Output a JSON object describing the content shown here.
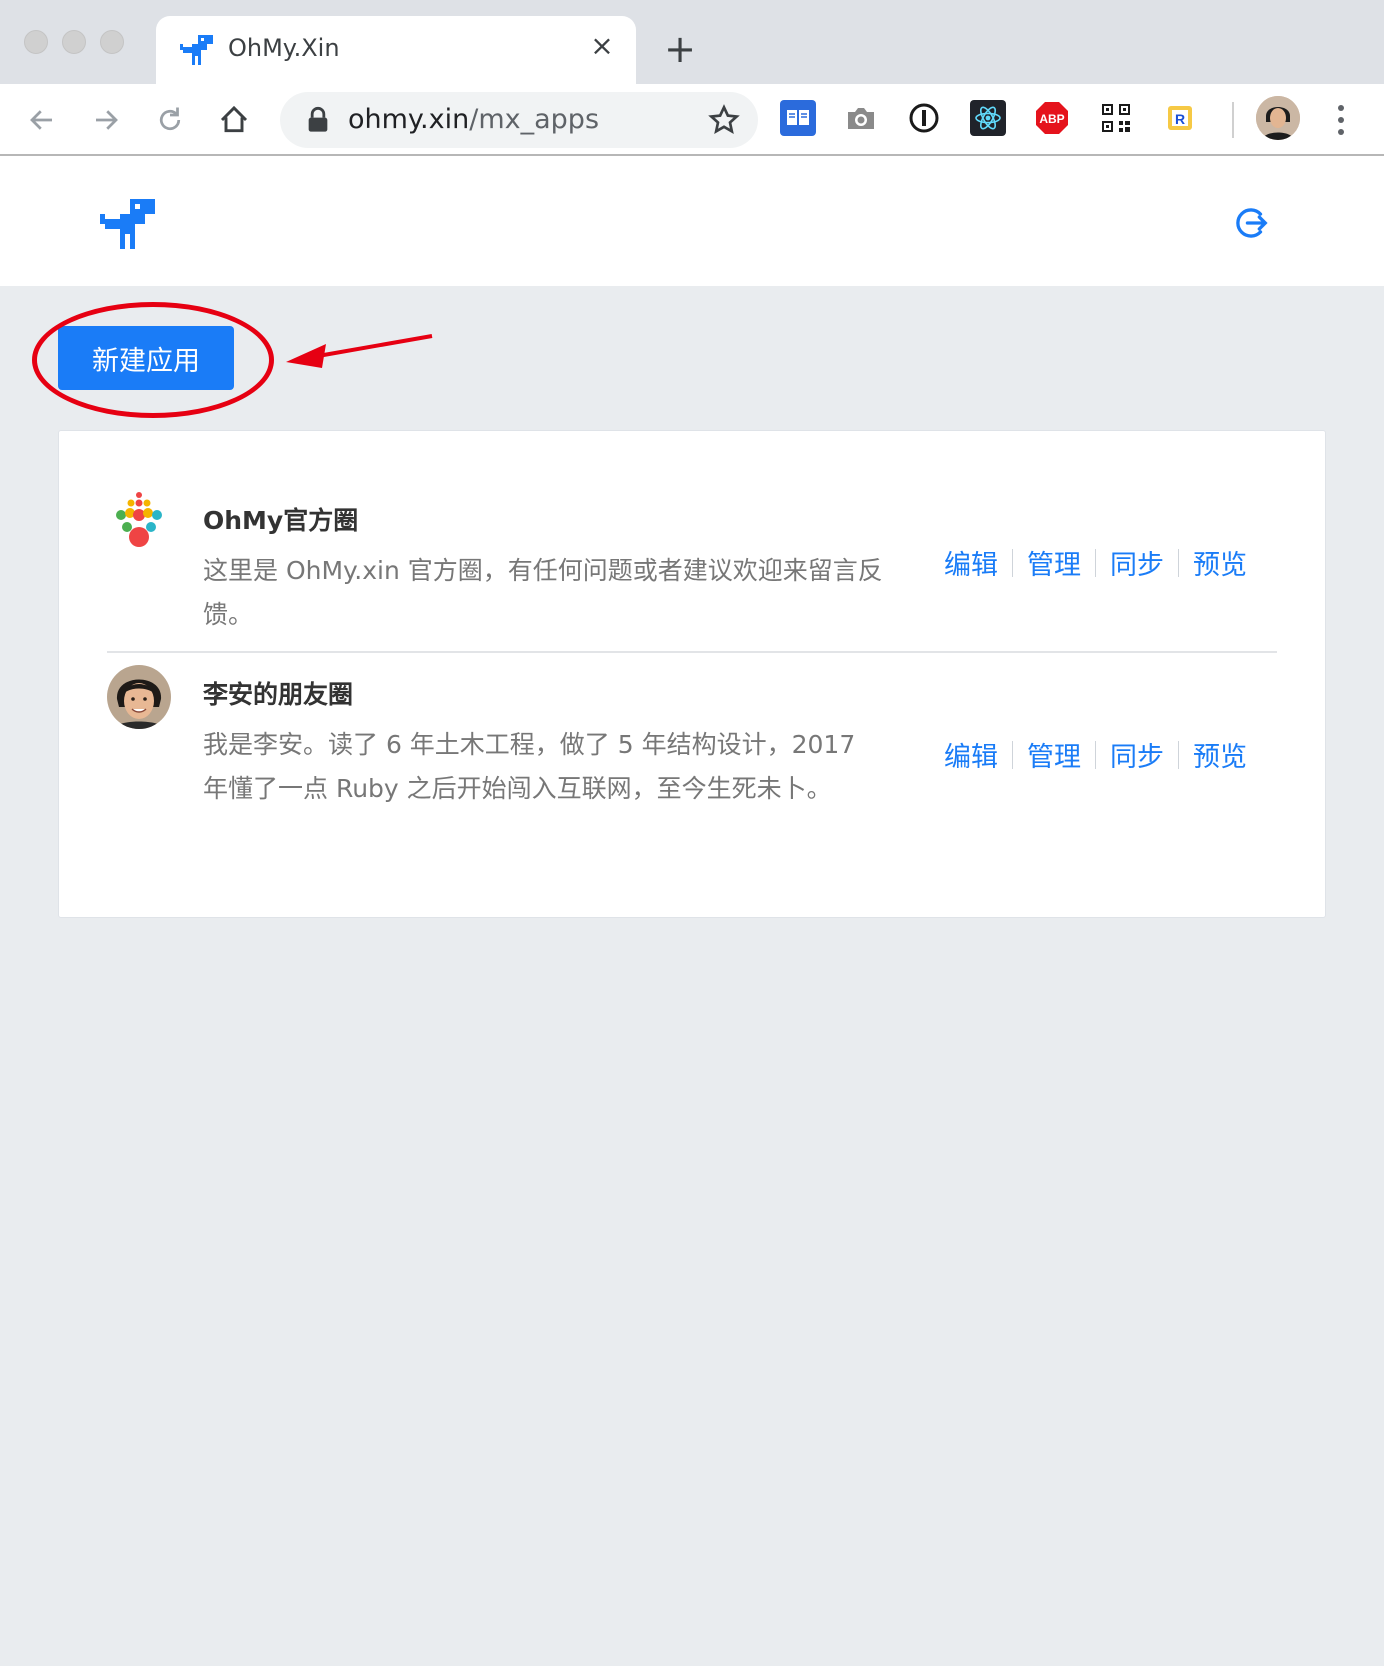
{
  "browser": {
    "tab_title": "OhMy.Xin",
    "tab_close": "×",
    "new_tab": "+",
    "url_host": "ohmy.xin",
    "url_path": "/mx_apps",
    "extensions": [
      "reader-mode-icon",
      "camera-icon",
      "1password-icon",
      "react-devtools-icon",
      "adblock-icon",
      "qr-code-icon",
      "reload-extension-icon"
    ],
    "extension_labels": {
      "adblock": "ABP",
      "reload": "R"
    }
  },
  "app": {
    "new_app_label": "新建应用",
    "accent_color": "#1a7cf7",
    "annotation_color": "#e60012"
  },
  "apps": [
    {
      "title": "OhMy官方圈",
      "description": "这里是 OhMy.xin 官方圈，有任何问题或者建议欢迎来留言反馈。",
      "actions": [
        "编辑",
        "管理",
        "同步",
        "预览"
      ]
    },
    {
      "title": "李安的朋友圈",
      "description": "我是李安。读了 6 年土木工程，做了 5 年结构设计，2017 年懂了一点 Ruby 之后开始闯入互联网，至今生死未卜。",
      "actions": [
        "编辑",
        "管理",
        "同步",
        "预览"
      ]
    }
  ]
}
